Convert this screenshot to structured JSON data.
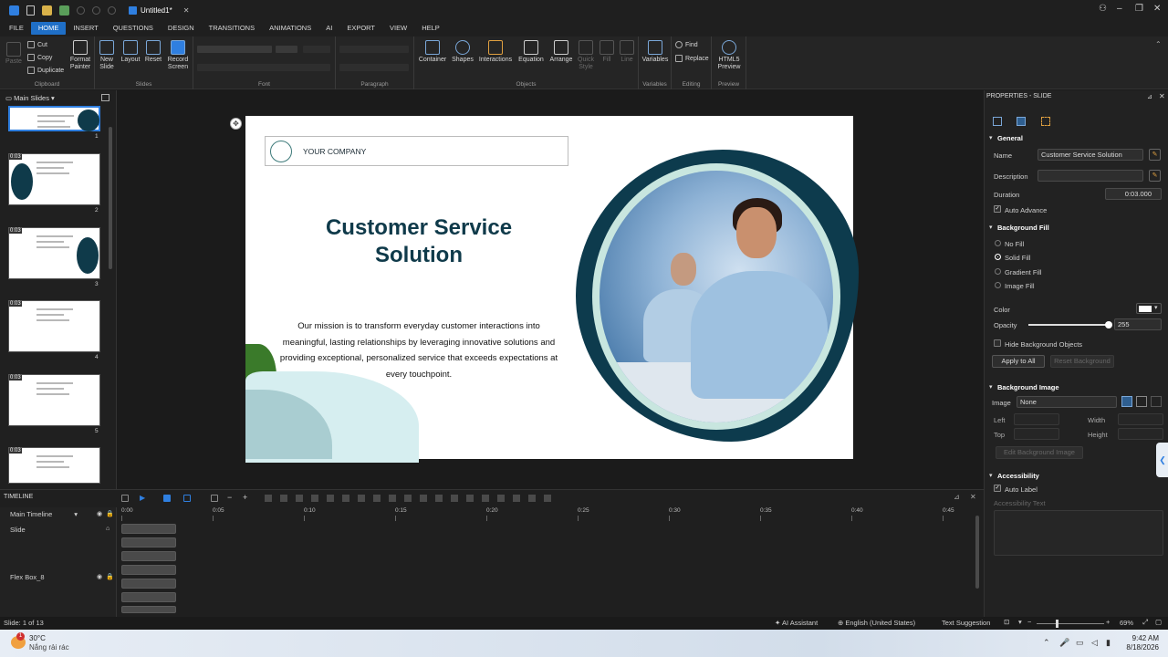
{
  "titlebar": {
    "doc_title": "Untitled1*"
  },
  "menu": {
    "items": [
      "FILE",
      "HOME",
      "INSERT",
      "QUESTIONS",
      "DESIGN",
      "TRANSITIONS",
      "ANIMATIONS",
      "AI",
      "EXPORT",
      "VIEW",
      "HELP"
    ],
    "active": "HOME"
  },
  "ribbon": {
    "clipboard": {
      "paste": "Paste",
      "cut": "Cut",
      "copy": "Copy",
      "duplicate": "Duplicate",
      "format_painter_1": "Format",
      "format_painter_2": "Painter",
      "group": "Clipboard"
    },
    "slides": {
      "new_1": "New",
      "new_2": "Slide",
      "layout": "Layout",
      "reset": "Reset",
      "record_1": "Record",
      "record_2": "Screen",
      "group": "Slides"
    },
    "font": {
      "group": "Font"
    },
    "paragraph": {
      "group": "Paragraph"
    },
    "objects": {
      "container": "Container",
      "shapes": "Shapes",
      "interactions": "Interactions",
      "equation": "Equation",
      "arrange": "Arrange",
      "quick_style_1": "Quick",
      "quick_style_2": "Style",
      "fill": "Fill",
      "line": "Line",
      "group": "Objects"
    },
    "variables": {
      "label": "Variables",
      "group": "Variables"
    },
    "editing": {
      "find": "Find",
      "replace": "Replace",
      "group": "Editing"
    },
    "preview": {
      "html5_1": "HTML5",
      "html5_2": "Preview",
      "group": "Preview"
    }
  },
  "slide_panel": {
    "title": "Main Slides",
    "thumbs": [
      {
        "num": "1",
        "time": ""
      },
      {
        "num": "2",
        "time": "0:03"
      },
      {
        "num": "3",
        "time": "0:03"
      },
      {
        "num": "4",
        "time": "0:03"
      },
      {
        "num": "5",
        "time": "0:03"
      },
      {
        "num": "",
        "time": "0:03"
      }
    ]
  },
  "slide": {
    "company": "YOUR COMPANY",
    "title_1": "Customer Service",
    "title_2": "Solution",
    "body_1": "Our mission is to transform everyday customer interactions into",
    "body_2": "meaningful, lasting relationships by leveraging innovative solutions and",
    "body_3": "providing exceptional, personalized service that exceeds expectations at",
    "body_4": "every touchpoint."
  },
  "properties": {
    "header": "PROPERTIES - SLIDE",
    "general": "General",
    "name_label": "Name",
    "name_value": "Customer Service Solution",
    "description_label": "Description",
    "description_value": "",
    "duration_label": "Duration",
    "duration_value": "0:03.000",
    "auto_advance": "Auto Advance",
    "background_fill": "Background Fill",
    "no_fill": "No Fill",
    "solid_fill": "Solid Fill",
    "gradient_fill": "Gradient Fill",
    "image_fill": "Image Fill",
    "color_label": "Color",
    "color_value": "#ffffff",
    "opacity_label": "Opacity",
    "opacity_value": "255",
    "opacity_level": 1.0,
    "hide_bg": "Hide Background Objects",
    "apply_all": "Apply to All",
    "reset_bg": "Reset Background",
    "background_image": "Background Image",
    "image_label": "Image",
    "image_value": "None",
    "left": "Left",
    "width": "Width",
    "top": "Top",
    "height": "Height",
    "edit_bg_image": "Edit Background Image",
    "accessibility": "Accessibility",
    "auto_label": "Auto Label",
    "accessibility_text": "Accessibility Text"
  },
  "timeline": {
    "title": "TIMELINE",
    "main_timeline": "Main Timeline",
    "rows": [
      "Slide",
      "Flex Box_8"
    ],
    "ticks": [
      "0:00",
      "0:05",
      "0:10",
      "0:15",
      "0:20",
      "0:25",
      "0:30",
      "0:35",
      "0:40",
      "0:45"
    ]
  },
  "status": {
    "slide_of": "Slide: 1 of 13",
    "ai_assistant": "AI Assistant",
    "language": "English (United States)",
    "text_suggestion": "Text Suggestion",
    "zoom": "69%"
  },
  "taskbar": {
    "weather_temp": "30°C",
    "weather_desc": "Nắng rải rác",
    "badge": "1",
    "time": "9:42 AM",
    "date": "8/18/2026"
  },
  "colors": {
    "accent": "#1f6fc7",
    "title": "#0f3a4a",
    "blob": "#0d3b4d"
  }
}
